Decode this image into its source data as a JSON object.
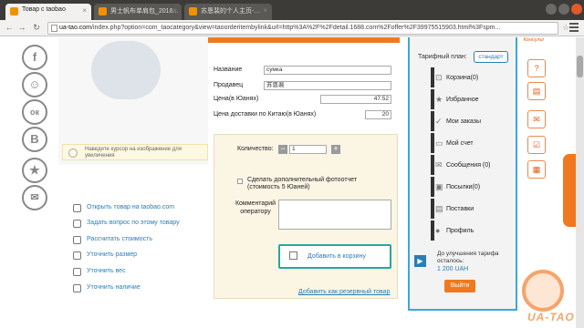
{
  "browser": {
    "tabs": [
      {
        "label": "Товар с taobao",
        "active": true
      },
      {
        "label": "男士帆布单肩包_2016...",
        "active": false
      },
      {
        "label": "苏恩裴的个人主页-…",
        "active": false
      }
    ],
    "url_host": "ua-tao.com",
    "url_path": "/index.php?option=com_taocategory&view=taoorderitembylink&url=http%3A%2F%2Fdetail.1688.com%2Foffer%2F39975515903.html%3Fspm..."
  },
  "sidebar_social": [
    "f",
    "☺",
    "ок",
    "В",
    "★",
    "✉"
  ],
  "image_hint": "Наведите курсор на изображение для увеличения",
  "actions": [
    {
      "label": "Открыть товар на taobao.com",
      "icon": "link-icon"
    },
    {
      "label": "Задать вопрос по этому товару",
      "icon": "chat-icon"
    },
    {
      "label": "Рассчитать стоимость",
      "icon": "calculator-icon"
    },
    {
      "label": "Уточнить размер",
      "icon": "ruler-icon"
    },
    {
      "label": "Уточнить вес",
      "icon": "scale-icon"
    },
    {
      "label": "Уточнить наличие",
      "icon": "box-icon"
    }
  ],
  "form": {
    "name_label": "Название",
    "name_value": "сумка",
    "seller_label": "Продавец",
    "seller_value": "苏恩裴",
    "price_label": "Цена(в Юанях)",
    "price_value": "47.52",
    "delivery_label": "Цена доставки по Китаю(в Юанях)",
    "delivery_value": "20",
    "qty_label": "Количество:",
    "qty_minus": "−",
    "qty_value": "1",
    "qty_plus": "+",
    "photo_label": "Сделать дополнительный фотоотчет (стоимость 5 Юаней)",
    "comment_label": "Комментарий оператору",
    "add_to_cart": "Добавить в корзину",
    "reserve_link": "Добавить как резервный товар"
  },
  "account": {
    "plan_label": "Тарифный план:",
    "plan_value": "стандарт",
    "menu": [
      {
        "label": "Корзина(0)",
        "icon": "cart-icon",
        "glyph": "⊡"
      },
      {
        "label": "Избранное",
        "icon": "star-icon",
        "glyph": "★"
      },
      {
        "label": "Мои заказы",
        "icon": "check-icon",
        "glyph": "✓"
      },
      {
        "label": "Мой счет",
        "icon": "wallet-icon",
        "glyph": "▭"
      },
      {
        "label": "Сообщения (0)",
        "icon": "message-icon",
        "glyph": "✉"
      },
      {
        "label": "Посылки(0)",
        "icon": "parcel-icon",
        "glyph": "▣"
      },
      {
        "label": "Поставки",
        "icon": "truck-icon",
        "glyph": "▤"
      },
      {
        "label": "Профиль",
        "icon": "user-icon",
        "glyph": "●"
      }
    ],
    "upgrade_text": "До улучшения тарифа осталось:",
    "upgrade_amount": "1 200 UAH",
    "exit_label": "Выйти"
  },
  "right_tools": {
    "consult_label": "Консульт",
    "icons": [
      "?",
      "▤",
      "✉",
      "☑",
      "▦"
    ]
  },
  "brand": {
    "logo_text": "UA-TAO",
    "accent": "#f0781e",
    "link": "#2a7db5"
  }
}
